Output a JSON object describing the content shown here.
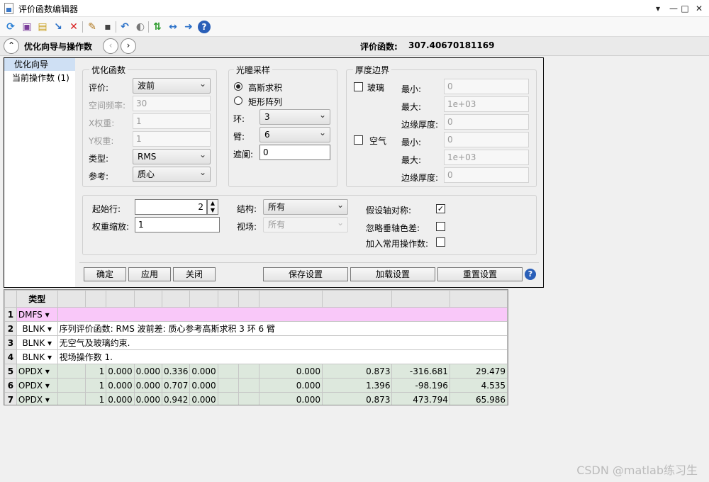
{
  "window": {
    "title": "评价函数编辑器",
    "buttons": {
      "dropdown": "▾",
      "minimize": "—",
      "maximize": "□",
      "close": "✕"
    }
  },
  "toolbar": {
    "icons": [
      "refresh-icon",
      "save-icon",
      "load-icon",
      "insert-icon",
      "delete-icon",
      "wizard-icon",
      "box-icon",
      "undo-icon",
      "toggle-icon",
      "sort-icon",
      "expand-icon",
      "arrow-right-icon",
      "help-icon"
    ]
  },
  "nav": {
    "back": "‹",
    "forward": "›",
    "title": "优化向导与操作数",
    "merit_label": "评价函数:",
    "merit_value": "307.40670181169"
  },
  "left": {
    "items": [
      "优化向导",
      "当前操作数 (1)"
    ]
  },
  "opt": {
    "title": "优化函数",
    "eval_label": "评价:",
    "eval_value": "波前",
    "freq_label": "空间频率:",
    "freq_value": "30",
    "xw_label": "X权重:",
    "xw_value": "1",
    "yw_label": "Y权重:",
    "yw_value": "1",
    "type_label": "类型:",
    "type_value": "RMS",
    "ref_label": "参考:",
    "ref_value": "质心"
  },
  "pupil": {
    "title": "光瞳采样",
    "gauss": "高斯求积",
    "rect": "矩形阵列",
    "ring_label": "环:",
    "ring_value": "3",
    "arm_label": "臂:",
    "arm_value": "6",
    "obs_label": "遮阑:",
    "obs_value": "0"
  },
  "thick": {
    "title": "厚度边界",
    "glass": "玻璃",
    "air": "空气",
    "min": "最小:",
    "max": "最大:",
    "edge": "边缘厚度:",
    "g_min": "0",
    "g_max": "1e+03",
    "g_edge": "0",
    "a_min": "0",
    "a_max": "1e+03",
    "a_edge": "0"
  },
  "lower": {
    "start_label": "起始行:",
    "start_value": "2",
    "wscale_label": "权重缩放:",
    "wscale_value": "1",
    "struct_label": "结构:",
    "struct_value": "所有",
    "field_label": "视场:",
    "field_value": "所有",
    "axis_sym": "假设轴对称:",
    "ignore_lat": "忽略垂轴色差:",
    "add_common": "加入常用操作数:",
    "axis_sym_check": "✓"
  },
  "buttons": {
    "ok": "确定",
    "apply": "应用",
    "close": "关闭",
    "save": "保存设置",
    "load": "加载设置",
    "reset": "重置设置",
    "help": "?"
  },
  "grid": {
    "header": "类型",
    "rows": [
      {
        "n": "1",
        "type": "DMFS ▾",
        "text": ""
      },
      {
        "n": "2",
        "type": "BLNK ▾",
        "text": "序列评价函数: RMS 波前差: 质心参考高斯求积 3 环 6 臂"
      },
      {
        "n": "3",
        "type": "BLNK ▾",
        "text": "无空气及玻璃约束."
      },
      {
        "n": "4",
        "type": "BLNK ▾",
        "text": "视场操作数 1."
      },
      {
        "n": "5",
        "type": "OPDX ▾",
        "c1": "1",
        "c2": "0.000",
        "c3": "0.000",
        "c4": "0.336",
        "c5": "0.000",
        "c8": "0.000",
        "c9": "0.873",
        "c10": "-316.681",
        "c11": "29.479"
      },
      {
        "n": "6",
        "type": "OPDX ▾",
        "c1": "1",
        "c2": "0.000",
        "c3": "0.000",
        "c4": "0.707",
        "c5": "0.000",
        "c8": "0.000",
        "c9": "1.396",
        "c10": "-98.196",
        "c11": "4.535"
      },
      {
        "n": "7",
        "type": "OPDX ▾",
        "c1": "1",
        "c2": "0.000",
        "c3": "0.000",
        "c4": "0.942",
        "c5": "0.000",
        "c8": "0.000",
        "c9": "0.873",
        "c10": "473.794",
        "c11": "65.986"
      }
    ]
  },
  "watermark": "CSDN @matlab练习生"
}
